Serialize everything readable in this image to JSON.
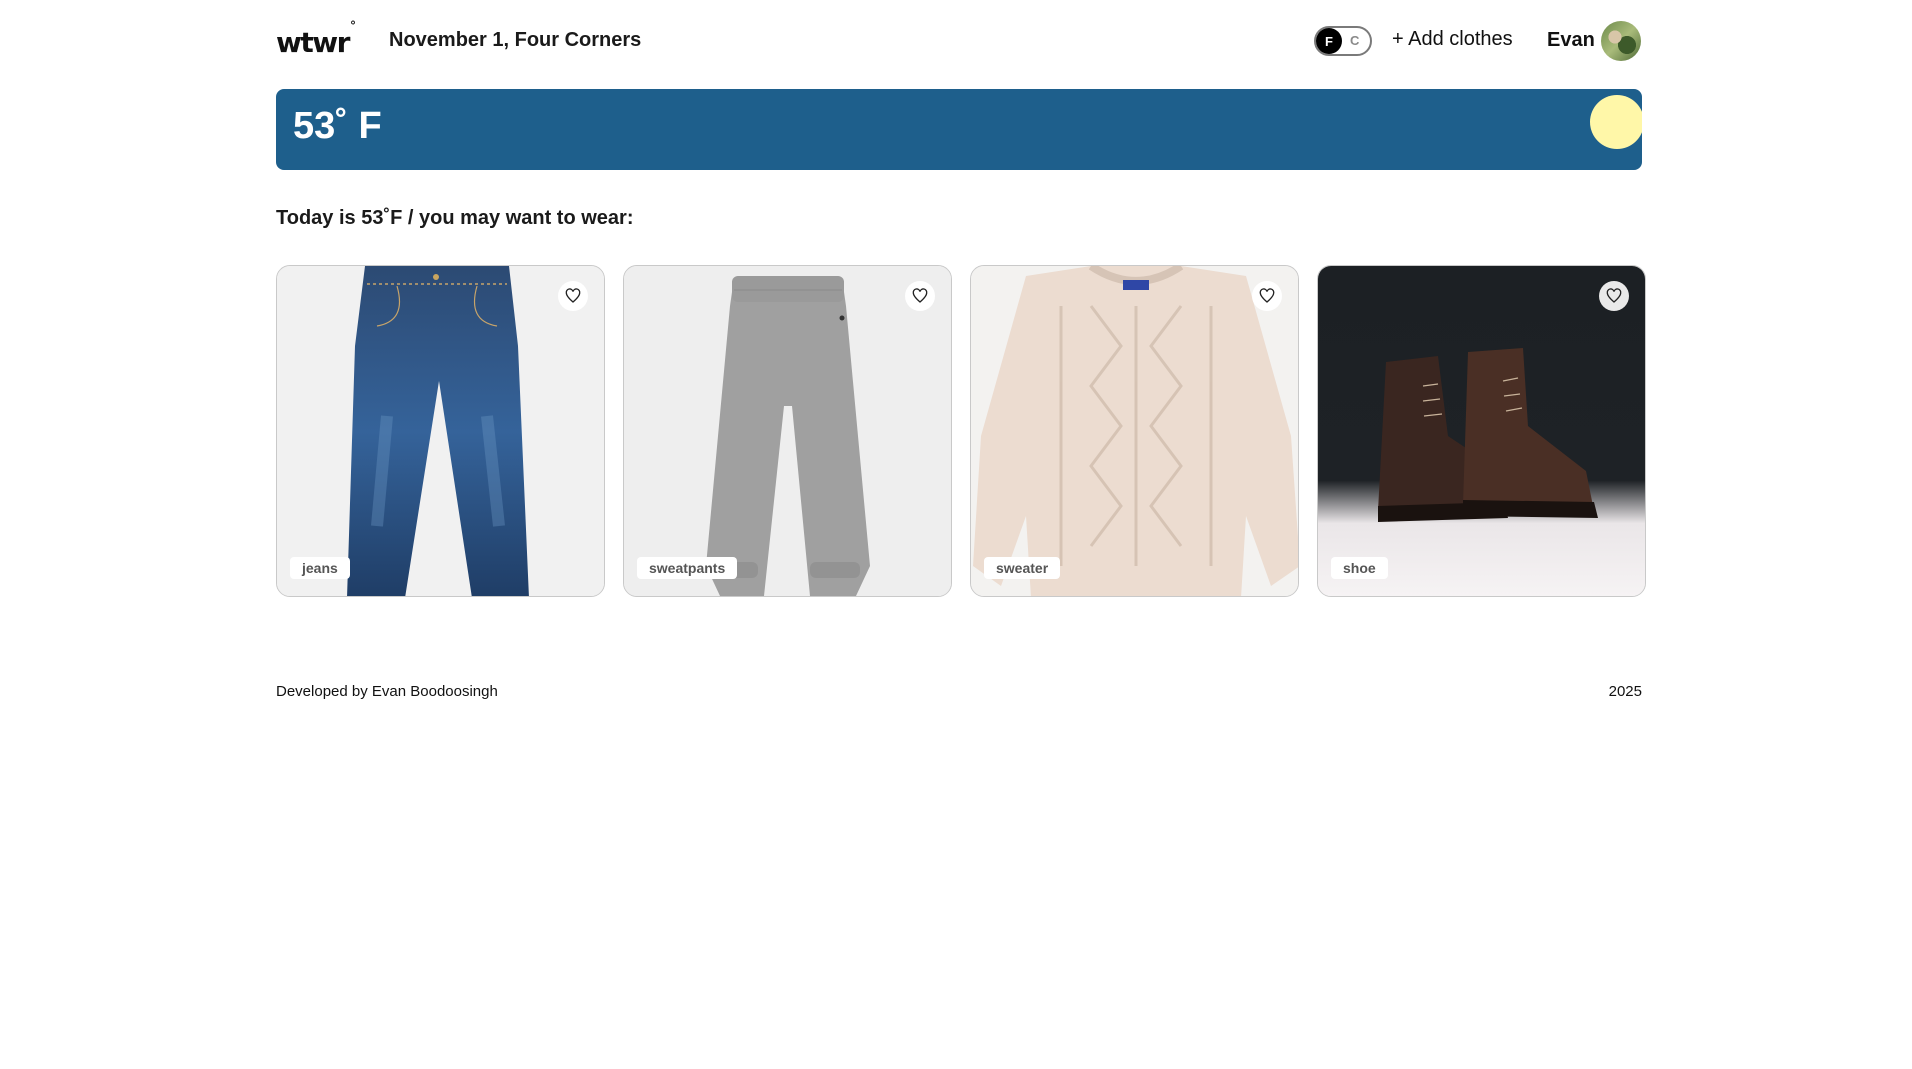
{
  "header": {
    "logo": "wtwr",
    "logo_mark": "°",
    "date_location": "November 1, Four Corners",
    "unit_active": "F",
    "unit_inactive": "C",
    "add_clothes_label": "+ Add clothes",
    "username": "Evan"
  },
  "weather": {
    "temperature_label": "53˚ F",
    "banner_color": "#1e5f8c",
    "sun_color": "#fff7a8"
  },
  "main": {
    "suggestion_text": "Today is 53˚F / you may want to wear:",
    "cards": [
      {
        "name": "jeans",
        "icon": "heart-icon"
      },
      {
        "name": "sweatpants",
        "icon": "heart-icon"
      },
      {
        "name": "sweater",
        "icon": "heart-icon"
      },
      {
        "name": "shoe",
        "icon": "heart-icon"
      }
    ]
  },
  "footer": {
    "credit": "Developed by Evan Boodoosingh",
    "year": "2025"
  }
}
